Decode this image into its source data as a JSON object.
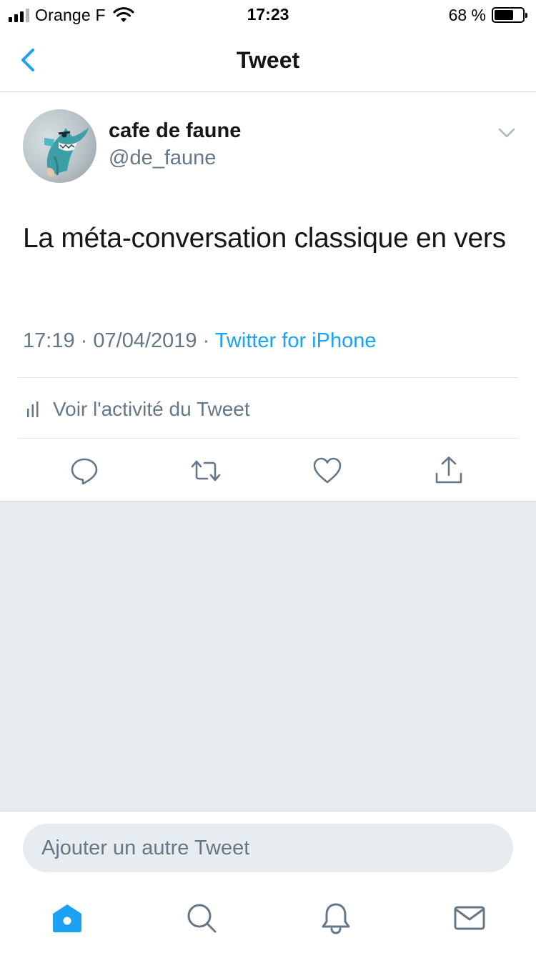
{
  "status_bar": {
    "carrier": "Orange F",
    "time": "17:23",
    "battery_percent": "68 %",
    "battery_level": 0.68,
    "signal_bars": 3
  },
  "nav": {
    "title": "Tweet",
    "back_icon": "chevron-left-icon"
  },
  "tweet": {
    "display_name": "cafe de faune",
    "handle": "@de_faune",
    "text": "La méta-conversation classique en vers",
    "time": "17:19",
    "separator": "·",
    "date": "07/04/2019",
    "source": "Twitter for iPhone",
    "activity_label": "Voir l'activité du Tweet",
    "actions": [
      "reply-icon",
      "retweet-icon",
      "like-icon",
      "share-icon"
    ]
  },
  "composer": {
    "placeholder": "Ajouter un autre Tweet",
    "value": ""
  },
  "tab_bar": {
    "tabs": [
      "home-icon",
      "search-icon",
      "notifications-icon",
      "messages-icon"
    ],
    "active": "home-icon"
  },
  "colors": {
    "accent": "#1da1f2",
    "text_primary": "#14171a",
    "text_secondary": "#657786",
    "divider": "#e1e8ed",
    "background_gray": "#e6ecf0"
  }
}
